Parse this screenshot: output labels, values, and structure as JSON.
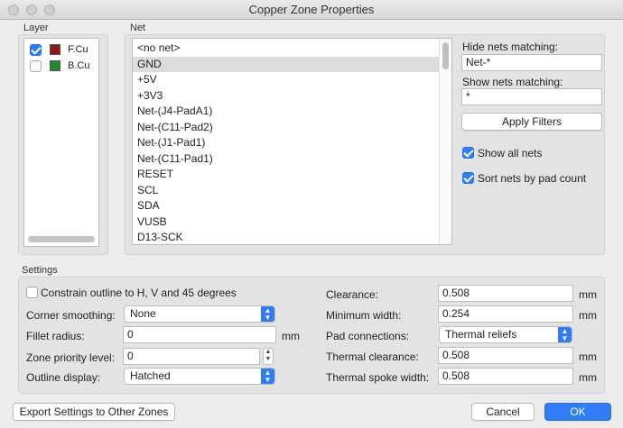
{
  "window": {
    "title": "Copper Zone Properties"
  },
  "layer_section": {
    "label": "Layer",
    "layers": [
      {
        "name": "F.Cu",
        "checked": true,
        "color": "#8b1a1a"
      },
      {
        "name": "B.Cu",
        "checked": false,
        "color": "#1e8a2b"
      }
    ]
  },
  "net_section": {
    "label": "Net",
    "nets": [
      "<no net>",
      "GND",
      "+5V",
      "+3V3",
      "Net-(J4-PadA1)",
      "Net-(C11-Pad2)",
      "Net-(J1-Pad1)",
      "Net-(C11-Pad1)",
      "RESET",
      "SCL",
      "SDA",
      "VUSB",
      "D13-SCK"
    ],
    "selected": "GND"
  },
  "filters": {
    "hide_label": "Hide nets matching:",
    "hide_value": "Net-*",
    "show_label": "Show nets matching:",
    "show_value": "*",
    "apply_label": "Apply Filters",
    "show_all_label": "Show all nets",
    "show_all_checked": true,
    "sort_label": "Sort nets by pad count",
    "sort_checked": true
  },
  "settings": {
    "label": "Settings",
    "constrain_label": "Constrain outline to H, V and 45 degrees",
    "constrain_checked": false,
    "corner_label": "Corner smoothing:",
    "corner_value": "None",
    "fillet_label": "Fillet radius:",
    "fillet_value": "0",
    "fillet_unit": "mm",
    "priority_label": "Zone priority level:",
    "priority_value": "0",
    "outline_label": "Outline display:",
    "outline_value": "Hatched",
    "clearance_label": "Clearance:",
    "clearance_value": "0.508",
    "min_width_label": "Minimum width:",
    "min_width_value": "0.254",
    "pad_conn_label": "Pad connections:",
    "pad_conn_value": "Thermal reliefs",
    "thermal_clearance_label": "Thermal clearance:",
    "thermal_clearance_value": "0.508",
    "spoke_label": "Thermal spoke width:",
    "spoke_value": "0.508",
    "unit": "mm"
  },
  "footer": {
    "export_label": "Export Settings to Other Zones",
    "cancel_label": "Cancel",
    "ok_label": "OK"
  }
}
